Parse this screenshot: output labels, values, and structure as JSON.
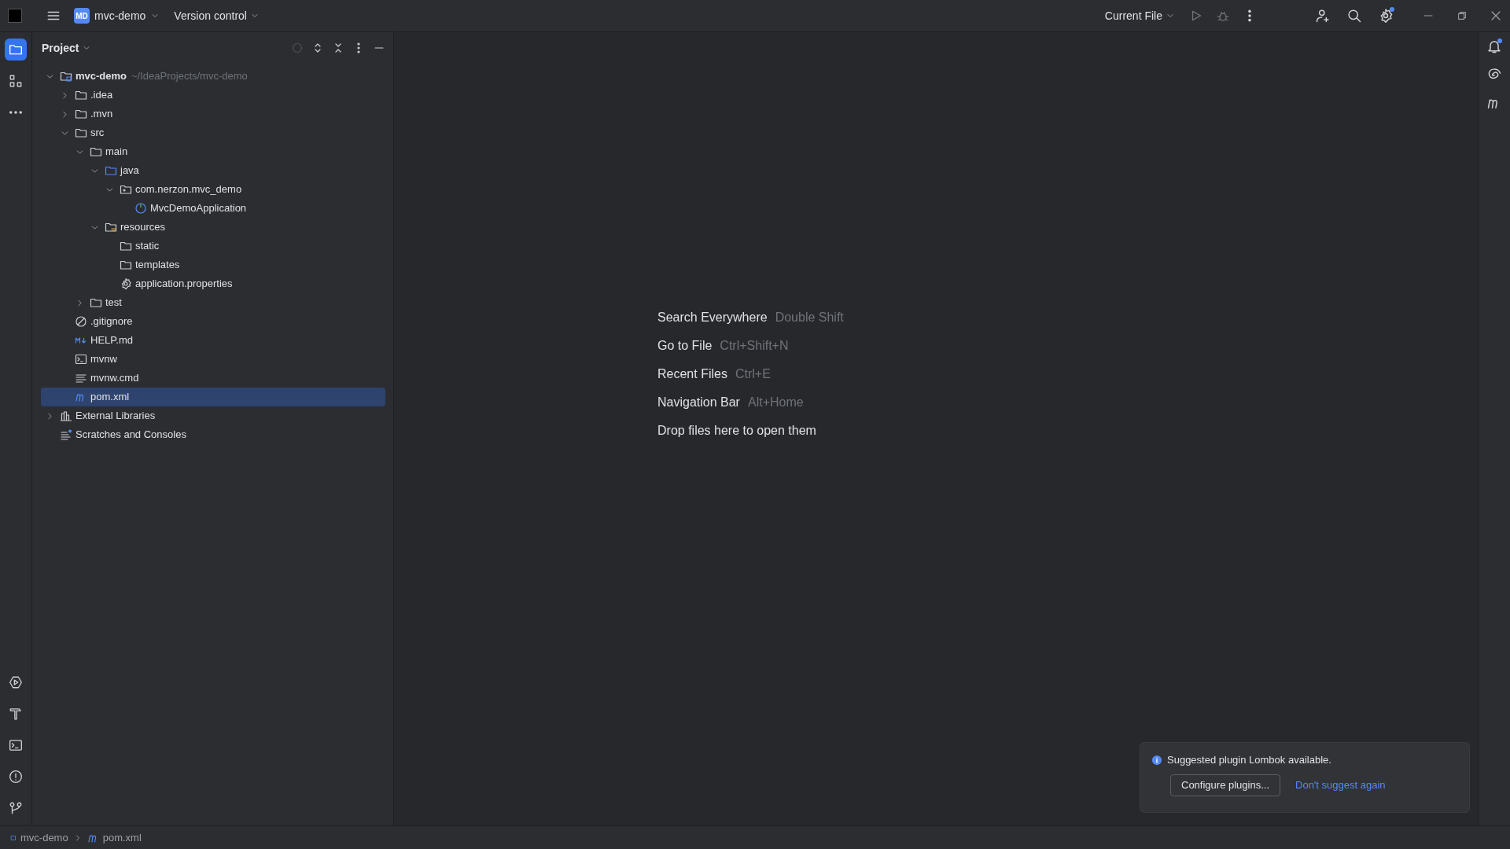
{
  "title_bar": {
    "project_badge": "MD",
    "project": "mvc-demo",
    "vcs": "Version control",
    "run_config": "Current File",
    "settings_badge": true
  },
  "left_stripe": {
    "top": [
      {
        "kind": "project",
        "selected": true
      },
      {
        "kind": "structure",
        "selected": false
      },
      {
        "kind": "more",
        "selected": false
      }
    ],
    "bottom": [
      {
        "kind": "services",
        "selected": false
      },
      {
        "kind": "build",
        "selected": false
      },
      {
        "kind": "terminal",
        "selected": false
      },
      {
        "kind": "problems",
        "selected": false
      },
      {
        "kind": "git",
        "selected": false
      }
    ]
  },
  "project_panel": {
    "title": "Project",
    "tree": [
      {
        "kind": "module",
        "label": "mvc-demo",
        "hint": "~/IdeaProjects/mvc-demo",
        "expanded": true,
        "selected": false,
        "children": [
          {
            "kind": "folder",
            "label": ".idea",
            "expanded": false,
            "selected": false
          },
          {
            "kind": "folder",
            "label": ".mvn",
            "expanded": false,
            "selected": false
          },
          {
            "kind": "folder",
            "label": "src",
            "expanded": true,
            "selected": false,
            "children": [
              {
                "kind": "folder",
                "label": "main",
                "expanded": true,
                "selected": false,
                "children": [
                  {
                    "kind": "source",
                    "label": "java",
                    "expanded": true,
                    "selected": false,
                    "children": [
                      {
                        "kind": "package",
                        "label": "com.nerzon.mvc_demo",
                        "expanded": true,
                        "selected": false,
                        "children": [
                          {
                            "kind": "spring",
                            "label": "MvcDemoApplication",
                            "selected": false
                          }
                        ]
                      }
                    ]
                  },
                  {
                    "kind": "resources",
                    "label": "resources",
                    "expanded": true,
                    "selected": false,
                    "children": [
                      {
                        "kind": "folder",
                        "label": "static",
                        "selected": false
                      },
                      {
                        "kind": "folder",
                        "label": "templates",
                        "selected": false
                      },
                      {
                        "kind": "properties",
                        "label": "application.properties",
                        "selected": false
                      }
                    ]
                  }
                ]
              },
              {
                "kind": "folder",
                "label": "test",
                "expanded": false,
                "selected": false
              }
            ]
          },
          {
            "kind": "gitignore",
            "label": ".gitignore",
            "selected": false
          },
          {
            "kind": "markdown",
            "label": "HELP.md",
            "selected": false
          },
          {
            "kind": "shell",
            "label": "mvnw",
            "selected": false
          },
          {
            "kind": "text",
            "label": "mvnw.cmd",
            "selected": false
          },
          {
            "kind": "maven",
            "label": "pom.xml",
            "selected": true
          }
        ]
      },
      {
        "kind": "libraries",
        "label": "External Libraries",
        "expanded": false,
        "selected": false
      },
      {
        "kind": "scratches",
        "label": "Scratches and Consoles",
        "selected": false
      }
    ]
  },
  "editor_empty": {
    "tips": [
      {
        "action": "Search Everywhere",
        "shortcut": "Double Shift"
      },
      {
        "action": "Go to File",
        "shortcut": "Ctrl+Shift+N"
      },
      {
        "action": "Recent Files",
        "shortcut": "Ctrl+E"
      },
      {
        "action": "Navigation Bar",
        "shortcut": "Alt+Home"
      },
      {
        "action": "Drop files here to open them"
      }
    ]
  },
  "right_stripe": {
    "notifications_badge": true
  },
  "notification": {
    "message": "Suggested plugin Lombok available.",
    "button": "Configure plugins...",
    "link": "Don't suggest again"
  },
  "status_bar": {
    "breadcrumbs": [
      {
        "kind": "module",
        "label": "mvc-demo"
      },
      {
        "kind": "maven",
        "label": "pom.xml"
      }
    ]
  }
}
